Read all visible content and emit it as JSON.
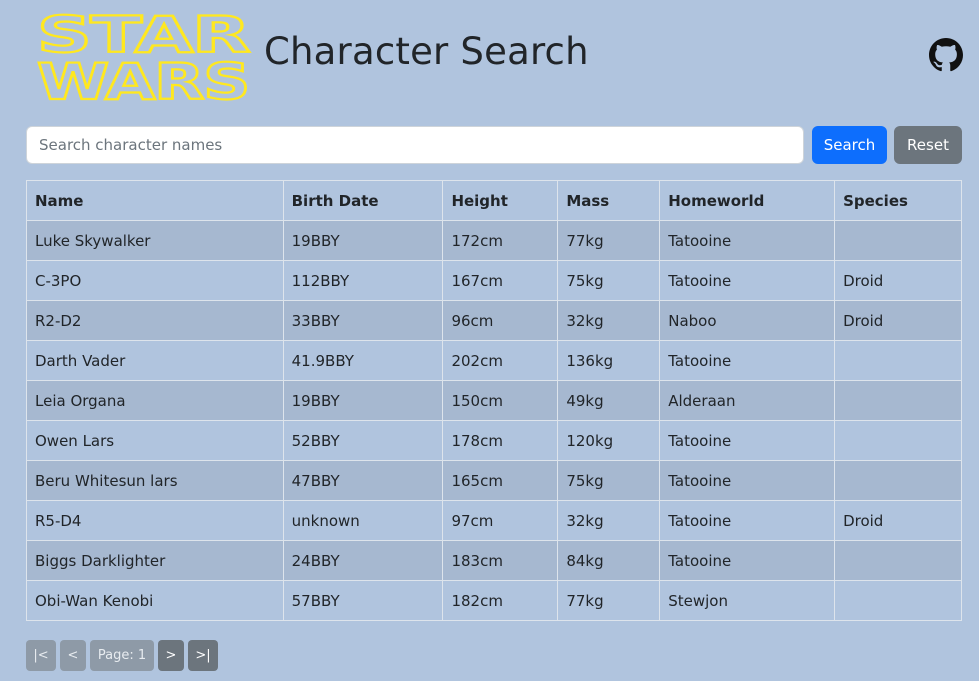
{
  "header": {
    "logo_text_top": "STAR",
    "logo_text_bottom": "WARS",
    "title": "Character Search",
    "github_icon": "github-icon"
  },
  "search": {
    "placeholder": "Search character names",
    "value": "",
    "search_label": "Search",
    "reset_label": "Reset"
  },
  "table": {
    "columns": [
      "Name",
      "Birth Date",
      "Height",
      "Mass",
      "Homeworld",
      "Species"
    ],
    "rows": [
      [
        "Luke Skywalker",
        "19BBY",
        "172cm",
        "77kg",
        "Tatooine",
        ""
      ],
      [
        "C-3PO",
        "112BBY",
        "167cm",
        "75kg",
        "Tatooine",
        "Droid"
      ],
      [
        "R2-D2",
        "33BBY",
        "96cm",
        "32kg",
        "Naboo",
        "Droid"
      ],
      [
        "Darth Vader",
        "41.9BBY",
        "202cm",
        "136kg",
        "Tatooine",
        ""
      ],
      [
        "Leia Organa",
        "19BBY",
        "150cm",
        "49kg",
        "Alderaan",
        ""
      ],
      [
        "Owen Lars",
        "52BBY",
        "178cm",
        "120kg",
        "Tatooine",
        ""
      ],
      [
        "Beru Whitesun lars",
        "47BBY",
        "165cm",
        "75kg",
        "Tatooine",
        ""
      ],
      [
        "R5-D4",
        "unknown",
        "97cm",
        "32kg",
        "Tatooine",
        "Droid"
      ],
      [
        "Biggs Darklighter",
        "24BBY",
        "183cm",
        "84kg",
        "Tatooine",
        ""
      ],
      [
        "Obi-Wan Kenobi",
        "57BBY",
        "182cm",
        "77kg",
        "Stewjon",
        ""
      ]
    ]
  },
  "pagination": {
    "first_label": "|<",
    "prev_label": "<",
    "page_label": "Page: 1",
    "next_label": ">",
    "last_label": ">|"
  },
  "colors": {
    "background": "#b0c4de",
    "logo_outline": "#ffe81f",
    "primary": "#0d6efd",
    "secondary": "#6c757d"
  }
}
